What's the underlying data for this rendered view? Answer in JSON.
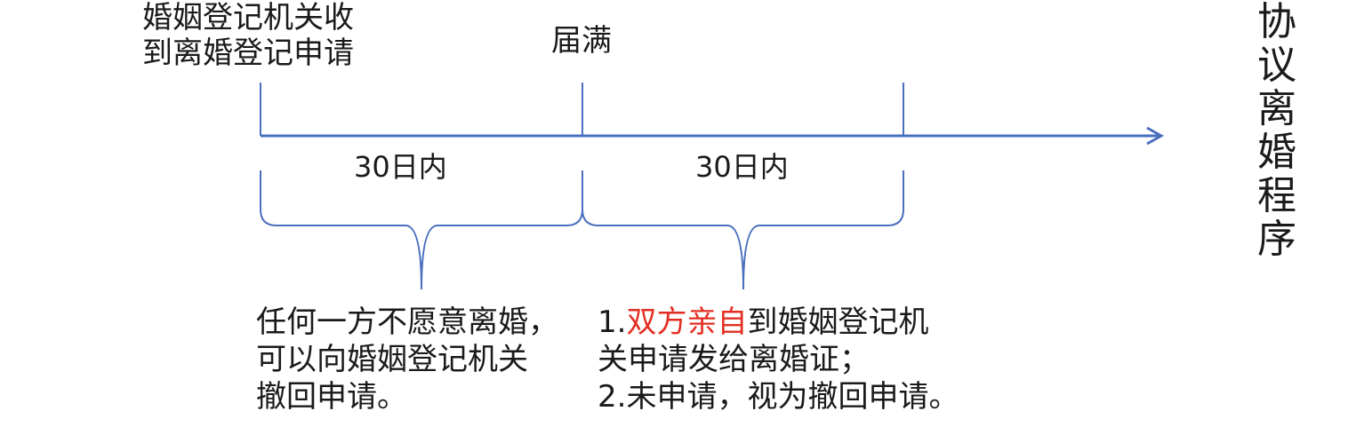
{
  "timeline": {
    "start_label_line1": "婚姻登记机关收",
    "start_label_line2": "到离婚登记申请",
    "expiry_label": "届满",
    "period_1": "30日内",
    "period_2": "30日内"
  },
  "notes": {
    "first_period": {
      "line1": "任何一方不愿意离婚，",
      "line2": "可以向婚姻登记机关",
      "line3": "撤回申请。"
    },
    "second_period": {
      "line1_prefix": "1.",
      "line1_highlight": "双方亲自",
      "line1_suffix": "到婚姻登记机",
      "line2": "关申请发给离婚证；",
      "line3": "2.未申请，视为撤回申请。"
    }
  },
  "side_title": "协议离婚程序",
  "colors": {
    "line": "#4a6fbf",
    "highlight": "#e32f23",
    "text": "#1a1a1a"
  }
}
